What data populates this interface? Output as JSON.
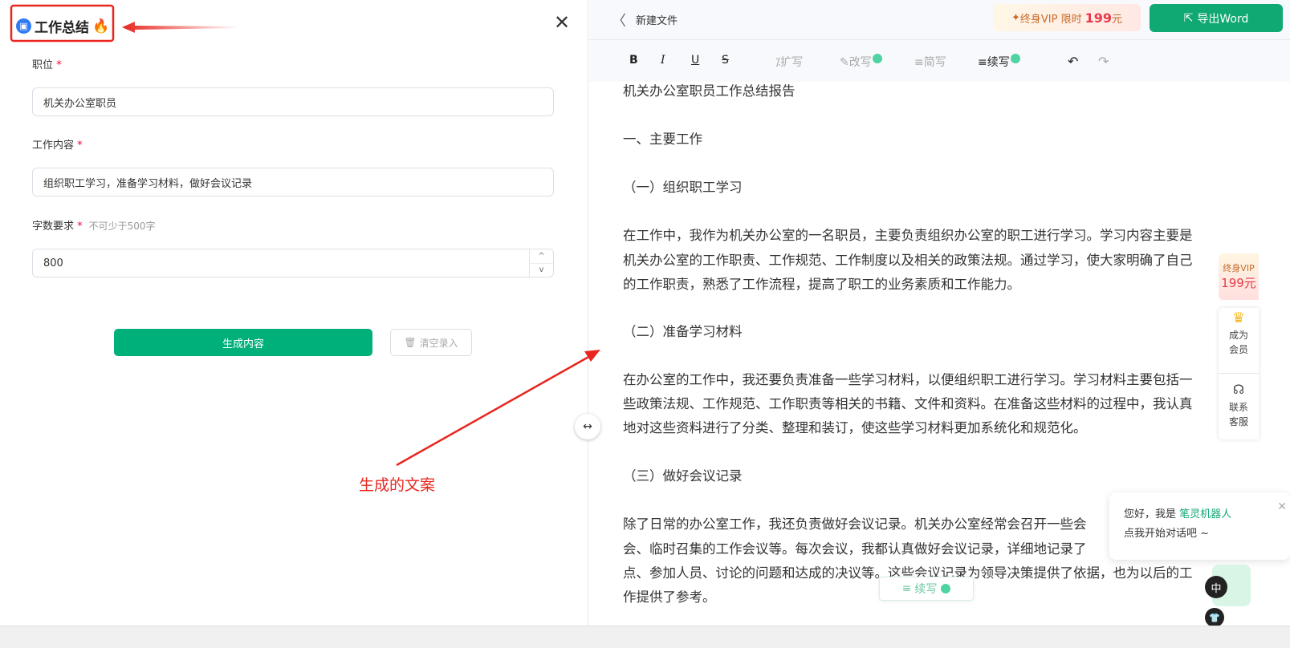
{
  "form": {
    "title": "工作总结",
    "title_emoji": "🔥",
    "fields": [
      {
        "label": "职位",
        "required": "*",
        "value": "机关办公室职员"
      },
      {
        "label": "工作内容",
        "required": "*",
        "value": "组织职工学习，准备学习材料，做好会议记录"
      },
      {
        "label": "字数要求",
        "required": "*",
        "hint": "不可少于500字",
        "value": "800"
      }
    ],
    "generate_label": "生成内容",
    "clear_label": "清空录入"
  },
  "header": {
    "file_name": "新建文件",
    "vip_text": "终身VIP 限时",
    "vip_price": "199",
    "vip_unit": "元",
    "export_label": "导出Word"
  },
  "toolbar": {
    "bold": "B",
    "italic": "I",
    "underline": "U",
    "strike": "S",
    "expand": "扩写",
    "rewrite": "改写",
    "simplify": "简写",
    "continue": "续写"
  },
  "document": {
    "lines": [
      "机关办公室职员工作总结报告",
      "一、主要工作",
      "（一）组织职工学习",
      "在工作中，我作为机关办公室的一名职员，主要负责组织办公室的职工进行学习。学习内容主要是",
      "机关办公室的工作职责、工作规范、工作制度以及相关的政策法规。通过学习，使大家明确了自己",
      "的工作职责，熟悉了工作流程，提高了职工的业务素质和工作能力。",
      "（二）准备学习材料",
      "在办公室的工作中，我还要负责准备一些学习材料，以便组织职工进行学习。学习材料主要包括一",
      "些政策法规、工作规范、工作职责等相关的书籍、文件和资料。在准备这些材料的过程中，我认真",
      "地对这些资料进行了分类、整理和装订，使这些学习材料更加系统化和规范化。",
      "（三）做好会议记录",
      "除了日常的办公室工作，我还负责做好会议记录。机关办公室经常会召开一些会",
      "会、临时召集的工作会议等。每次会议，我都认真做好会议记录，详细地记录了",
      "点、参加人员、讨论的问题和达成的决议等。这些会议记录为领导决策提供了依据，也为以后的工",
      "作提供了参考。"
    ]
  },
  "float_continue": "续写",
  "sidebar": {
    "vip_top": "终身VIP",
    "vip_price": "199元",
    "member": "成为会员",
    "service": "联系客服"
  },
  "chat_popup": {
    "greeting": "您好，我是",
    "bot_name": "笔灵机器人",
    "prompt": "点我开始对话吧 ~"
  },
  "ime": {
    "lang": "中"
  },
  "annotation": {
    "text": "生成的文案",
    "color": "#e8261f"
  },
  "colors": {
    "primary": "#00b07a",
    "price": "#e63a4a",
    "required": "#ff0033"
  }
}
